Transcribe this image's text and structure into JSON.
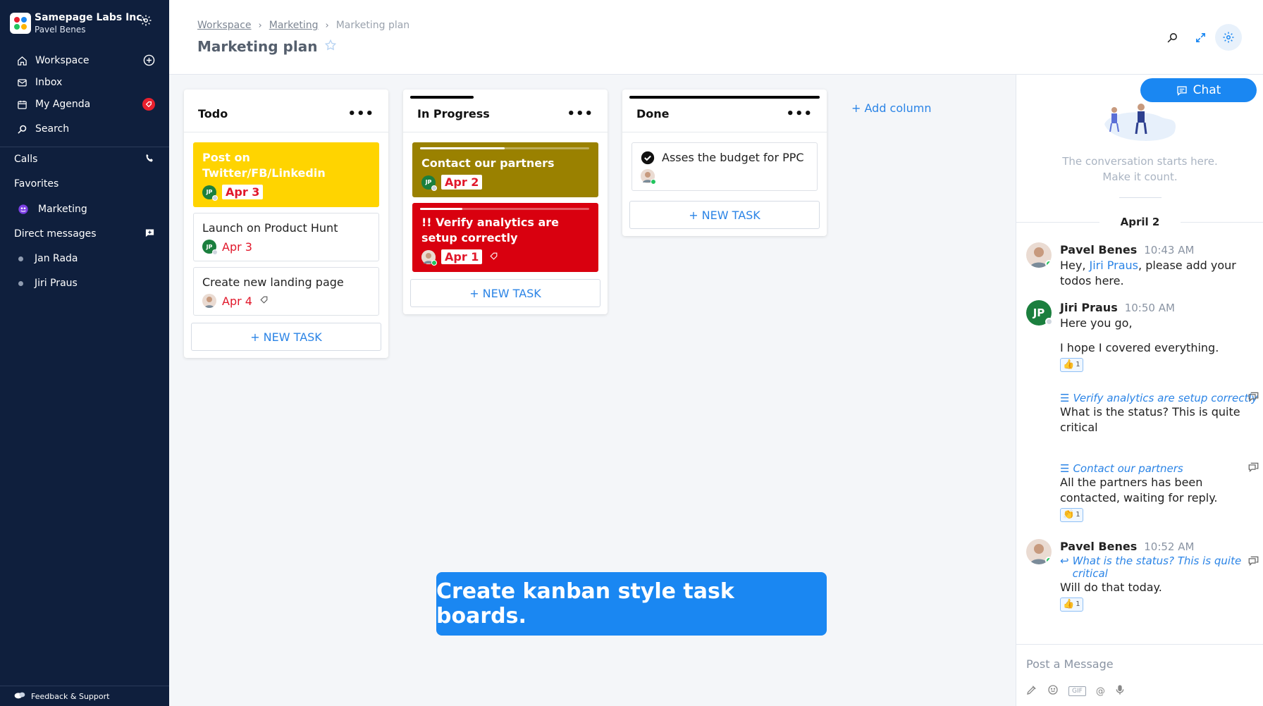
{
  "org": {
    "name": "Samepage Labs Inc.",
    "user": "Pavel Benes"
  },
  "sidebar": {
    "items": [
      {
        "label": "Workspace",
        "icon": "home-icon"
      },
      {
        "label": "Inbox",
        "icon": "inbox-icon"
      },
      {
        "label": "My Agenda",
        "icon": "calendar-icon"
      },
      {
        "label": "Search",
        "icon": "search-icon"
      }
    ],
    "calls": "Calls",
    "favorites": "Favorites",
    "favorite_items": [
      {
        "label": "Marketing",
        "icon": "group-icon"
      }
    ],
    "direct_messages": "Direct messages",
    "dm_items": [
      {
        "label": "Jan Rada"
      },
      {
        "label": "Jiri Praus"
      }
    ],
    "feedback": "Feedback & Support"
  },
  "header": {
    "breadcrumbs": [
      "Workspace",
      "Marketing",
      "Marketing plan"
    ],
    "title": "Marketing plan"
  },
  "board": {
    "columns": [
      {
        "title": "Todo",
        "menu": "•••",
        "cards": [
          {
            "title": "Post on Twitter/FB/Linkedin",
            "assignee": "JP",
            "date": "Apr 3",
            "color": "#ffd400"
          },
          {
            "title": "Launch on Product Hunt",
            "assignee": "JP",
            "date": "Apr 3"
          },
          {
            "title": "Create new landing page",
            "assignee": "Pavel Benes",
            "date": "Apr 4"
          }
        ],
        "new_task": "+ NEW TASK"
      },
      {
        "title": "In Progress",
        "menu": "•••",
        "cards": [
          {
            "title": "Contact our partners",
            "assignee": "JP",
            "date": "Apr 2",
            "color": "#9a8100",
            "progress": 0.5
          },
          {
            "title": "!! Verify analytics are setup correctly",
            "assignee": "Pavel Benes",
            "date": "Apr 1",
            "color": "#d9000f",
            "progress": 0.25
          }
        ],
        "new_task": "+ NEW TASK"
      },
      {
        "title": "Done",
        "menu": "•••",
        "cards": [
          {
            "title": "Asses the budget for PPC",
            "assignee": "Pavel Benes",
            "completed": true
          }
        ],
        "new_task": "+ NEW TASK"
      }
    ],
    "add_column": "+ Add column"
  },
  "banner": "Create kanban style task boards.",
  "chat": {
    "button": "Chat",
    "conversation_start": [
      "The conversation starts here.",
      "Make it count."
    ],
    "day": "April 2",
    "messages": [
      {
        "author": "Pavel Benes",
        "time": "10:43 AM",
        "text_before": "Hey, ",
        "mention": "Jiri Praus",
        "text_after": ", please add your todos here."
      },
      {
        "author": "Jiri Praus",
        "initials": "JP",
        "time": "10:50 AM",
        "lines": [
          "Here you go,",
          "I hope I covered everything."
        ],
        "reaction": {
          "emoji": "👍",
          "count": "1"
        }
      },
      {
        "task": "Verify analytics are setup correctly",
        "text": "What is the status? This is quite critical"
      },
      {
        "task": "Contact our partners",
        "text": "All the partners has been contacted, waiting for reply.",
        "reaction": {
          "emoji": "👏",
          "count": "1"
        }
      },
      {
        "author": "Pavel Benes",
        "time": "10:52 AM",
        "reply_to": "What is the status? This is quite critical",
        "text": "Will do that today.",
        "reaction": {
          "emoji": "👍",
          "count": "1"
        }
      }
    ],
    "composer_placeholder": "Post a Message",
    "composer_gif": "GIF",
    "composer_at": "@"
  },
  "colors": {
    "sidebar": "#0f1f3d",
    "accent": "#1a87f2",
    "danger": "#e1182b",
    "online": "#22c55e"
  }
}
